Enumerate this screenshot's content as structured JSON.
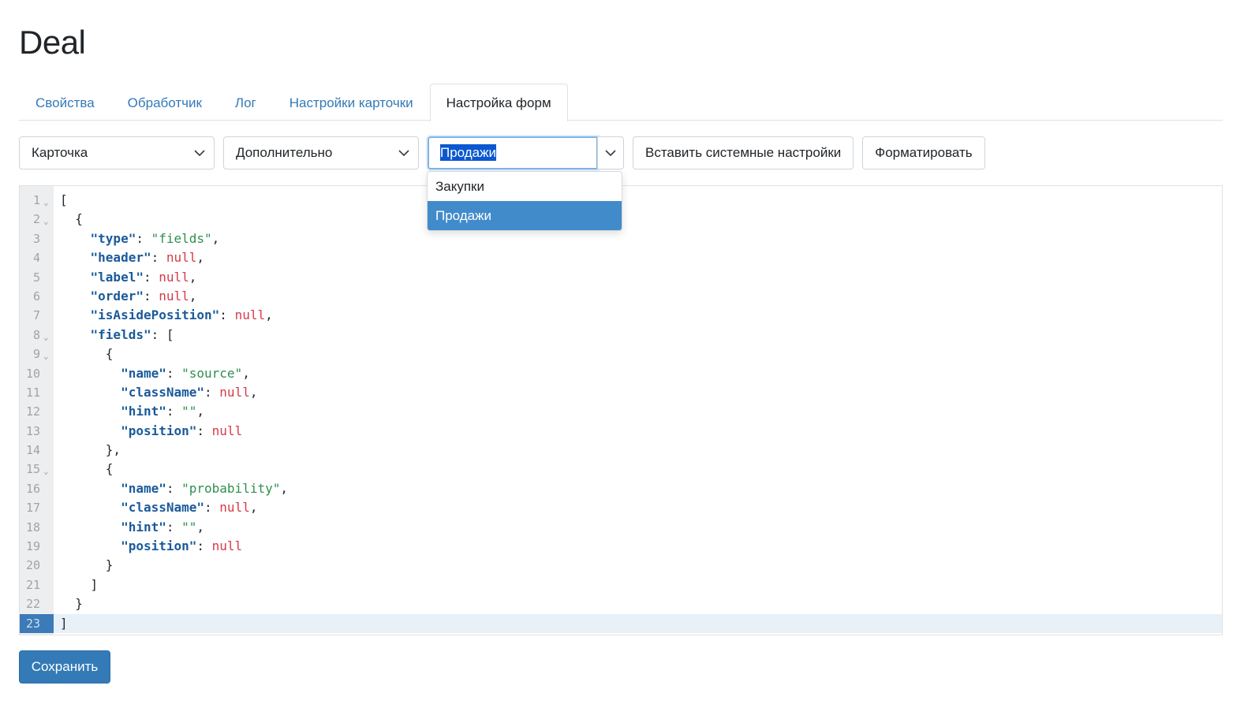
{
  "page": {
    "title": "Deal"
  },
  "tabs": [
    {
      "label": "Свойства",
      "active": false
    },
    {
      "label": "Обработчик",
      "active": false
    },
    {
      "label": "Лог",
      "active": false
    },
    {
      "label": "Настройки карточки",
      "active": false
    },
    {
      "label": "Настройка форм",
      "active": true
    }
  ],
  "toolbar": {
    "view_select": {
      "value": "Карточка"
    },
    "section_select": {
      "value": "Дополнительно"
    },
    "form_combo": {
      "value": "Продажи",
      "options": [
        "Закупки",
        "Продажи"
      ],
      "selected": "Продажи"
    },
    "insert_system_label": "Вставить системные настройки",
    "format_label": "Форматировать"
  },
  "editor": {
    "current_line": 23,
    "lines": [
      "[",
      "  {",
      "    \"type\": \"fields\",",
      "    \"header\": null,",
      "    \"label\": null,",
      "    \"order\": null,",
      "    \"isAsidePosition\": null,",
      "    \"fields\": [",
      "      {",
      "        \"name\": \"source\",",
      "        \"className\": null,",
      "        \"hint\": \"\",",
      "        \"position\": null",
      "      },",
      "      {",
      "        \"name\": \"probability\",",
      "        \"className\": null,",
      "        \"hint\": \"\",",
      "        \"position\": null",
      "      }",
      "    ]",
      "  }",
      "]"
    ],
    "foldable_lines": [
      1,
      2,
      8,
      9,
      15
    ]
  },
  "footer": {
    "save_label": "Сохранить"
  },
  "colors": {
    "accent": "#337ab7",
    "dropdown_active": "#428bca",
    "json_key": "#1a5a9a",
    "json_string": "#2f8f4f",
    "json_null": "#d73a49"
  }
}
